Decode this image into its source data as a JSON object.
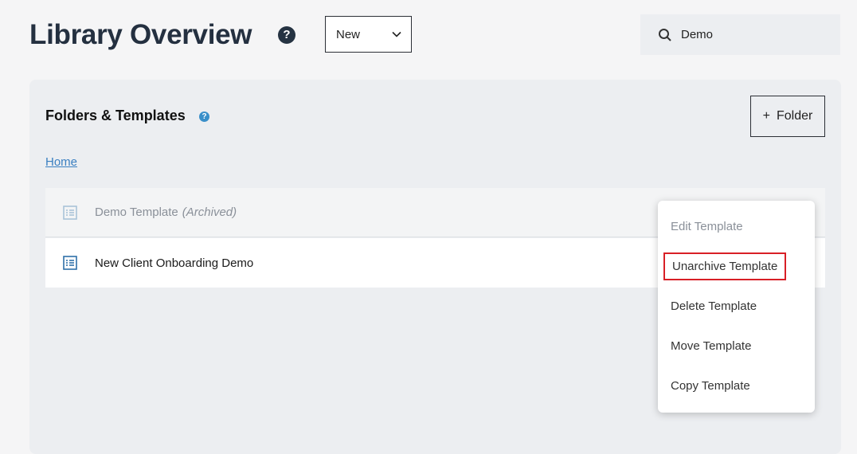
{
  "header": {
    "title": "Library Overview",
    "help_icon": "question-circle-icon",
    "new_select": {
      "value": "New"
    },
    "search": {
      "value": "Demo"
    }
  },
  "panel": {
    "title": "Folders & Templates",
    "folder_button": {
      "plus": "+",
      "label": "Folder"
    },
    "breadcrumb": "Home",
    "rows": [
      {
        "name": "Demo Template",
        "tag": "(Archived)",
        "icon": "template-list-icon"
      },
      {
        "name": "New Client Onboarding Demo",
        "icon": "template-list-icon"
      }
    ]
  },
  "context_menu": {
    "items": [
      {
        "label": "Edit Template"
      },
      {
        "label": "Unarchive Template"
      },
      {
        "label": "Delete Template"
      },
      {
        "label": "Move Template"
      },
      {
        "label": "Copy Template"
      }
    ]
  },
  "colors": {
    "accent_link": "#3a7fc1",
    "help_small": "#3a8fc9",
    "highlight_border": "#d81f26",
    "panel_bg": "#eceef1"
  }
}
